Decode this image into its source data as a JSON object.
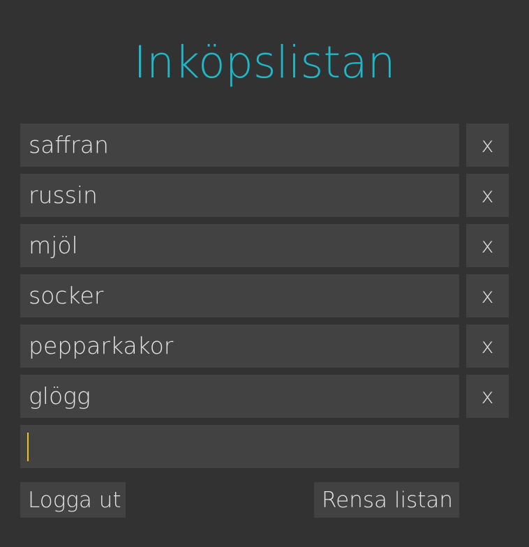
{
  "app": {
    "title": "Inköpslistan"
  },
  "items": [
    {
      "label": "saffran",
      "remove_label": "x"
    },
    {
      "label": "russin",
      "remove_label": "x"
    },
    {
      "label": "mjöl",
      "remove_label": "x"
    },
    {
      "label": "socker",
      "remove_label": "x"
    },
    {
      "label": "pepparkakor",
      "remove_label": "x"
    },
    {
      "label": "glögg",
      "remove_label": "x"
    }
  ],
  "new_item": {
    "value": "",
    "placeholder": ""
  },
  "actions": {
    "logout_label": "Logga ut",
    "clear_label": "Rensa listan"
  },
  "colors": {
    "background": "#323232",
    "surface": "#424242",
    "accent": "#1fb8c9",
    "caret": "#f0c419",
    "text": "#e4e4e4"
  }
}
